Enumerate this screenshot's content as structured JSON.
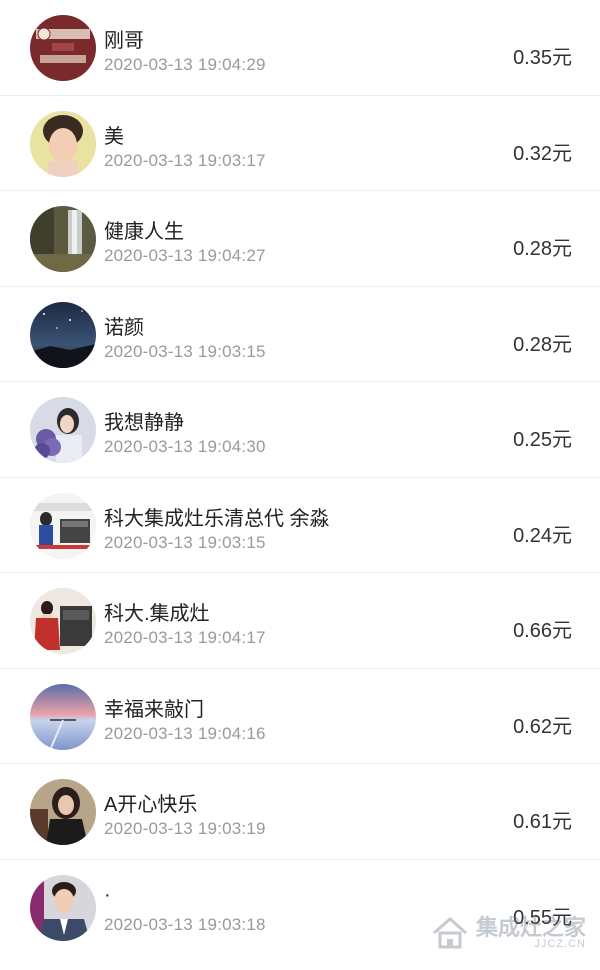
{
  "rows": [
    {
      "name": "刚哥",
      "time": "2020-03-13 19:04:29",
      "amount": "0.35元",
      "avatar": "seal-stamp-avatar"
    },
    {
      "name": "美",
      "time": "2020-03-13 19:03:17",
      "amount": "0.32元",
      "avatar": "woman-portrait-avatar"
    },
    {
      "name": "健康人生",
      "time": "2020-03-13 19:04:27",
      "amount": "0.28元",
      "avatar": "waterfall-landscape-avatar"
    },
    {
      "name": "诺颜",
      "time": "2020-03-13 19:03:15",
      "amount": "0.28元",
      "avatar": "night-sky-avatar"
    },
    {
      "name": "我想静静",
      "time": "2020-03-13 19:04:30",
      "amount": "0.25元",
      "avatar": "girl-with-flowers-avatar"
    },
    {
      "name": "科大集成灶乐清总代 余淼",
      "time": "2020-03-13 19:03:15",
      "amount": "0.24元",
      "avatar": "kitchen-store-avatar"
    },
    {
      "name": "科大.集成灶",
      "time": "2020-03-13 19:04:17",
      "amount": "0.66元",
      "avatar": "kitchen-stove-avatar"
    },
    {
      "name": "幸福来敲门",
      "time": "2020-03-13 19:04:16",
      "amount": "0.62元",
      "avatar": "sunset-lake-avatar"
    },
    {
      "name": "A开心快乐",
      "time": "2020-03-13 19:03:19",
      "amount": "0.61元",
      "avatar": "woman-dark-hair-avatar"
    },
    {
      "name": "·",
      "time": "2020-03-13 19:03:18",
      "amount": "0.55元",
      "avatar": "man-suit-avatar"
    }
  ],
  "watermark": {
    "main": "集成灶之家",
    "sub": "JJCZ.CN"
  }
}
